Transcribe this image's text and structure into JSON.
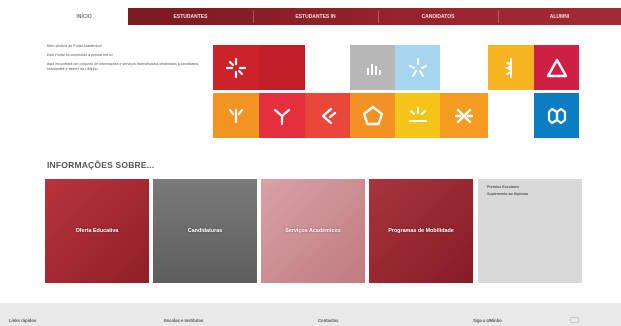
{
  "nav": {
    "home": "INÍCIO",
    "items": [
      "ESTUDANTES",
      "ESTUDANTES IN",
      "CANDIDATOS",
      "ALUMNI"
    ]
  },
  "intro": {
    "p1": "Bem-vindo/a ao Portal Académico!",
    "p2": "Este Portal foi construído a pensar em si!",
    "p3": "Aqui encontrará um conjunto de informações e serviços diversificados destinados a candidatos, estudantes e alumni da UMinho."
  },
  "tiles": [
    {
      "icon": "star-burst-icon",
      "color": "#cc2229"
    },
    {
      "icon": "blank-red-tile",
      "color": "#c21e26"
    },
    {
      "icon": "bar-grid-icon",
      "color": "#b7b7b7"
    },
    {
      "icon": "sparkle-icon",
      "color": "#a7d4ee"
    },
    {
      "icon": "caduceus-icon",
      "color": "#f6b322"
    },
    {
      "icon": "triangle-icon",
      "color": "#cf1f45"
    },
    {
      "icon": "fork-icon",
      "color": "#f39422"
    },
    {
      "icon": "tree-icon",
      "color": "#e62f3c"
    },
    {
      "icon": "chevron-icon",
      "color": "#e84739"
    },
    {
      "icon": "pentagon-icon",
      "color": "#f39222"
    },
    {
      "icon": "sunrise-icon",
      "color": "#f4c419"
    },
    {
      "icon": "cross-icon",
      "color": "#f59a23"
    },
    {
      "icon": "hexagon-icon",
      "color": "#0b7ec2"
    }
  ],
  "section": {
    "title": "INFORMAÇÕES SOBRE...",
    "cards": [
      {
        "label": "Oferta Educativa",
        "color": "#a62a33"
      },
      {
        "label": "Candidaturas",
        "color": "#6d6d6d"
      },
      {
        "label": "Serviços Académicos",
        "color": "#c98a8f"
      },
      {
        "label": "Programas de Mobilidade",
        "color": "#962631"
      }
    ],
    "side_links": [
      "Prémios Escolares",
      "Suplemento ao Diploma"
    ]
  },
  "footer": {
    "items": [
      "Links rápidos",
      "Escolas e Institutos",
      "Contactos",
      "Siga a UMinho"
    ]
  }
}
